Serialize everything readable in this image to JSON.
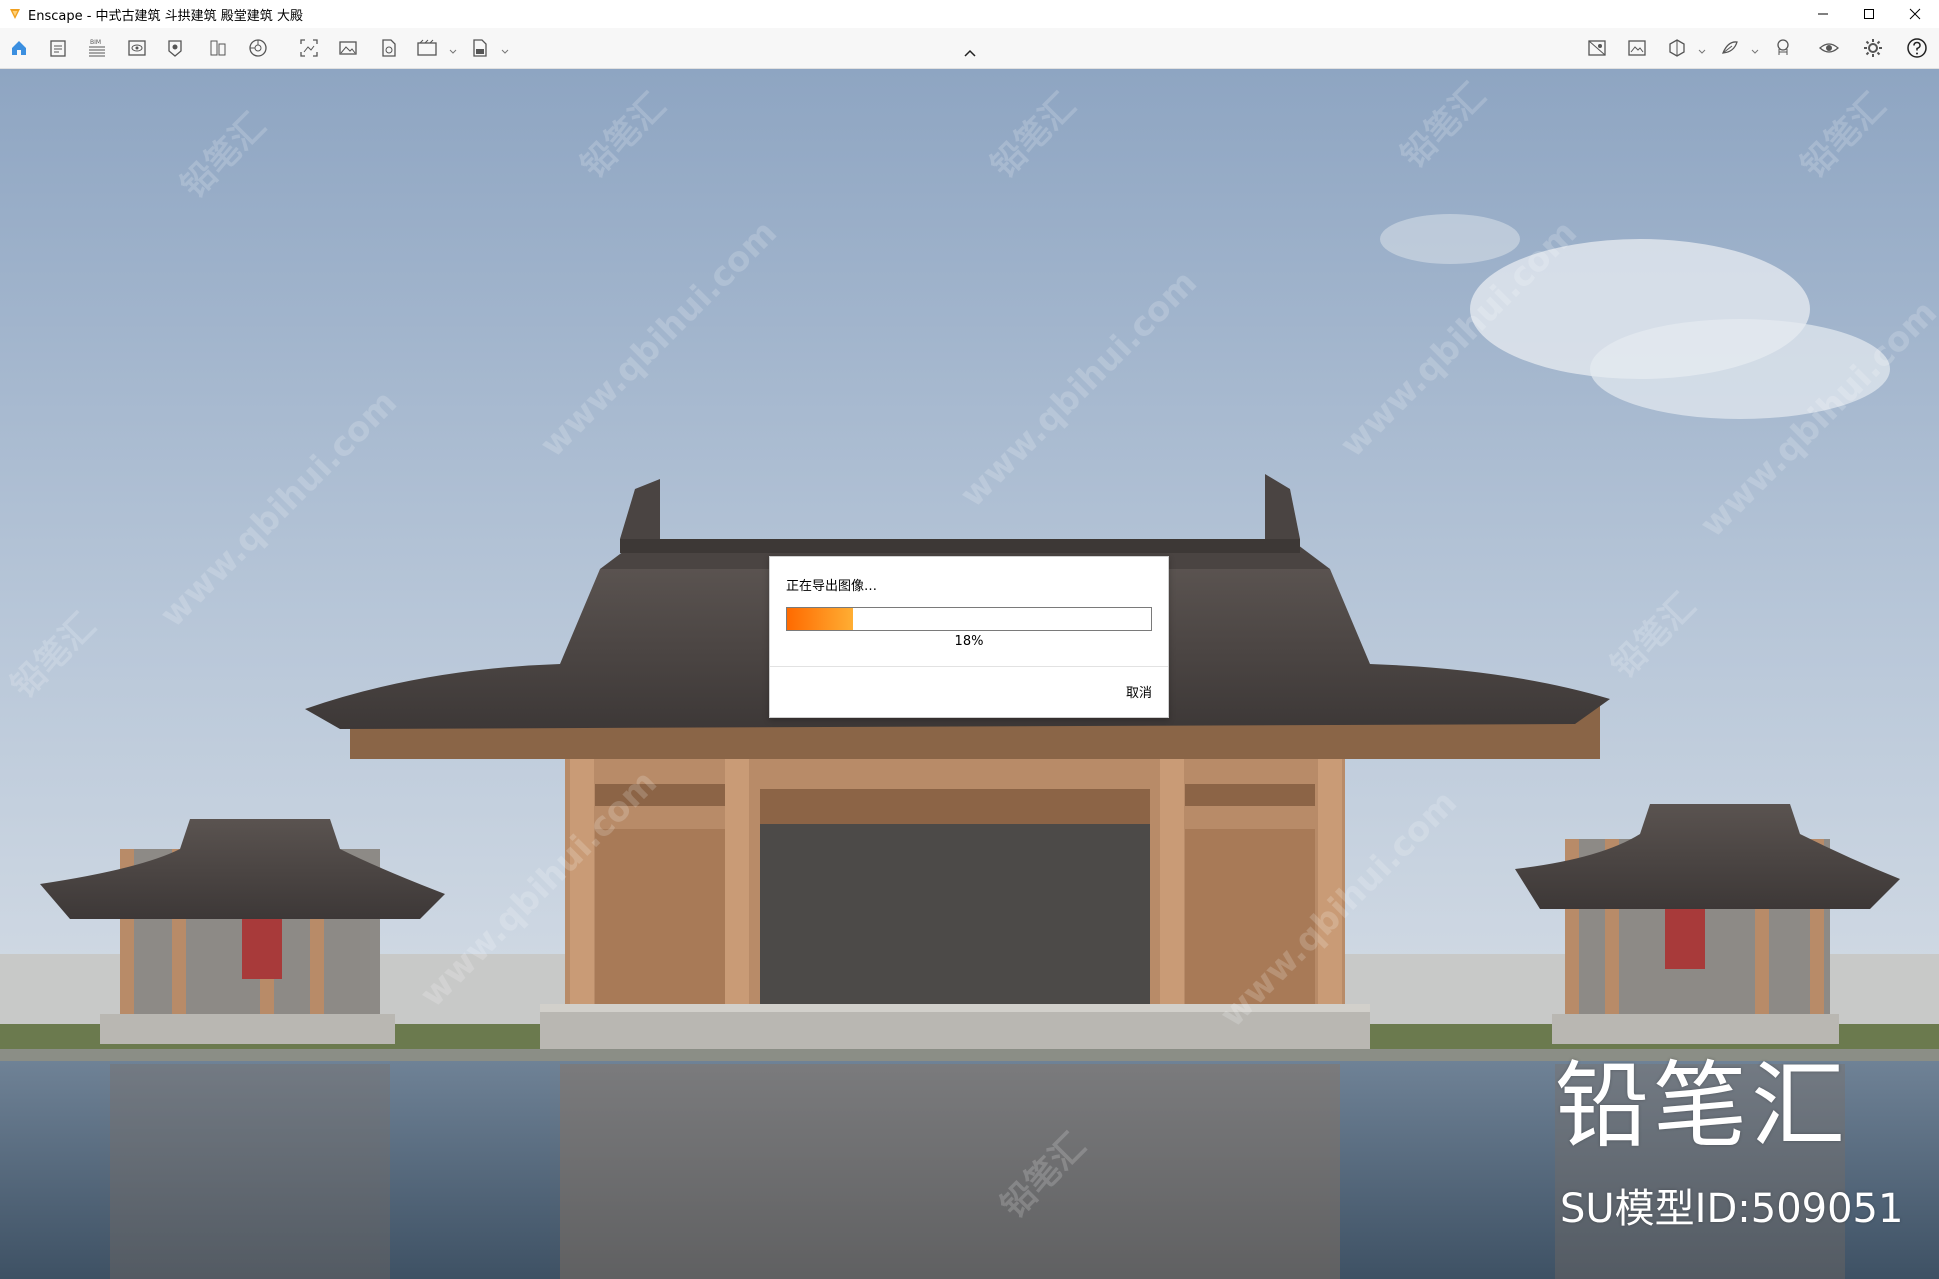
{
  "window": {
    "title": "Enscape - 中式古建筑 斗拱建筑 殿堂建筑 大殿",
    "accent": "#f0a020"
  },
  "toolbar": {
    "left_icons": [
      "home-icon",
      "notes-icon",
      "bim-icon",
      "visual-settings-icon",
      "capture-icon",
      "views-icon",
      "atmosphere-icon",
      "screenshot-icon",
      "panorama-icon",
      "batch-render-icon",
      "video-icon",
      "export-icon"
    ],
    "bim_label": "BIM",
    "collapse_icon": "chevron-up-icon",
    "right_icons": [
      "site-context-icon",
      "image-gallery-icon",
      "view-mode-icon",
      "material-icon",
      "asset-library-icon",
      "live-view-icon",
      "settings-icon",
      "help-icon"
    ]
  },
  "watermark": {
    "brand": "铅笔汇",
    "url": "www.qbihui.com",
    "model_id": "SU模型ID:509051"
  },
  "dialog": {
    "message": "正在导出图像…",
    "progress_percent": 18,
    "progress_text": "18%",
    "cancel_label": "取消",
    "progress_colors": [
      "#ff6a00",
      "#ffae33"
    ]
  }
}
